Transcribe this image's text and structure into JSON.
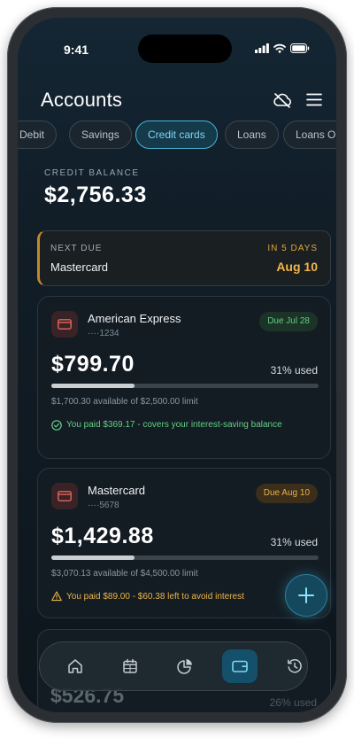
{
  "status_bar": {
    "time": "9:41",
    "icons": [
      "signal-icon",
      "wifi-icon",
      "battery-icon"
    ]
  },
  "header": {
    "title": "Accounts",
    "icons": [
      "cloud-off-icon",
      "menu-icon"
    ]
  },
  "tabs": [
    {
      "label": "Debit",
      "active": false
    },
    {
      "label": "Savings",
      "active": false
    },
    {
      "label": "Credit cards",
      "active": true
    },
    {
      "label": "Loans",
      "active": false
    },
    {
      "label": "Loans Ou",
      "active": false
    }
  ],
  "balance": {
    "label": "CREDIT BALANCE",
    "value": "$2,756.33"
  },
  "next_due": {
    "label": "NEXT DUE",
    "name": "Mastercard",
    "days_label": "IN 5 DAYS",
    "date": "Aug 10"
  },
  "cards": [
    {
      "name": "American Express",
      "number": "····1234",
      "due": "Due Jul 28",
      "amount": "$799.70",
      "used_label": "31% used",
      "used_fraction": 0.31,
      "available": "$1,700.30 available of $2,500.00 limit",
      "note": "You paid $369.17 - covers your interest-saving balance",
      "note_icon": "check-circle-icon"
    },
    {
      "name": "Mastercard",
      "number": "····5678",
      "due": "Due Aug 10",
      "amount": "$1,429.88",
      "used_label": "31% used",
      "used_fraction": 0.31,
      "available": "$3,070.13 available of $4,500.00 limit",
      "note": "You paid $89.00 - $60.38 left to avoid interest",
      "note_icon": "warning-icon"
    }
  ],
  "partial_card": {
    "amount": "$526.75",
    "used_label": "26% used"
  },
  "fab": {
    "icon": "plus-icon"
  },
  "bottom_nav": [
    {
      "icon": "home-icon",
      "active": false
    },
    {
      "icon": "calendar-icon",
      "active": false
    },
    {
      "icon": "pie-chart-icon",
      "active": false
    },
    {
      "icon": "wallet-icon",
      "active": true
    },
    {
      "icon": "history-icon",
      "active": false
    }
  ],
  "colors": {
    "accent": "#48b3d6",
    "success": "#5fcf88",
    "warning": "#eab14a",
    "background": "#0e161d"
  }
}
